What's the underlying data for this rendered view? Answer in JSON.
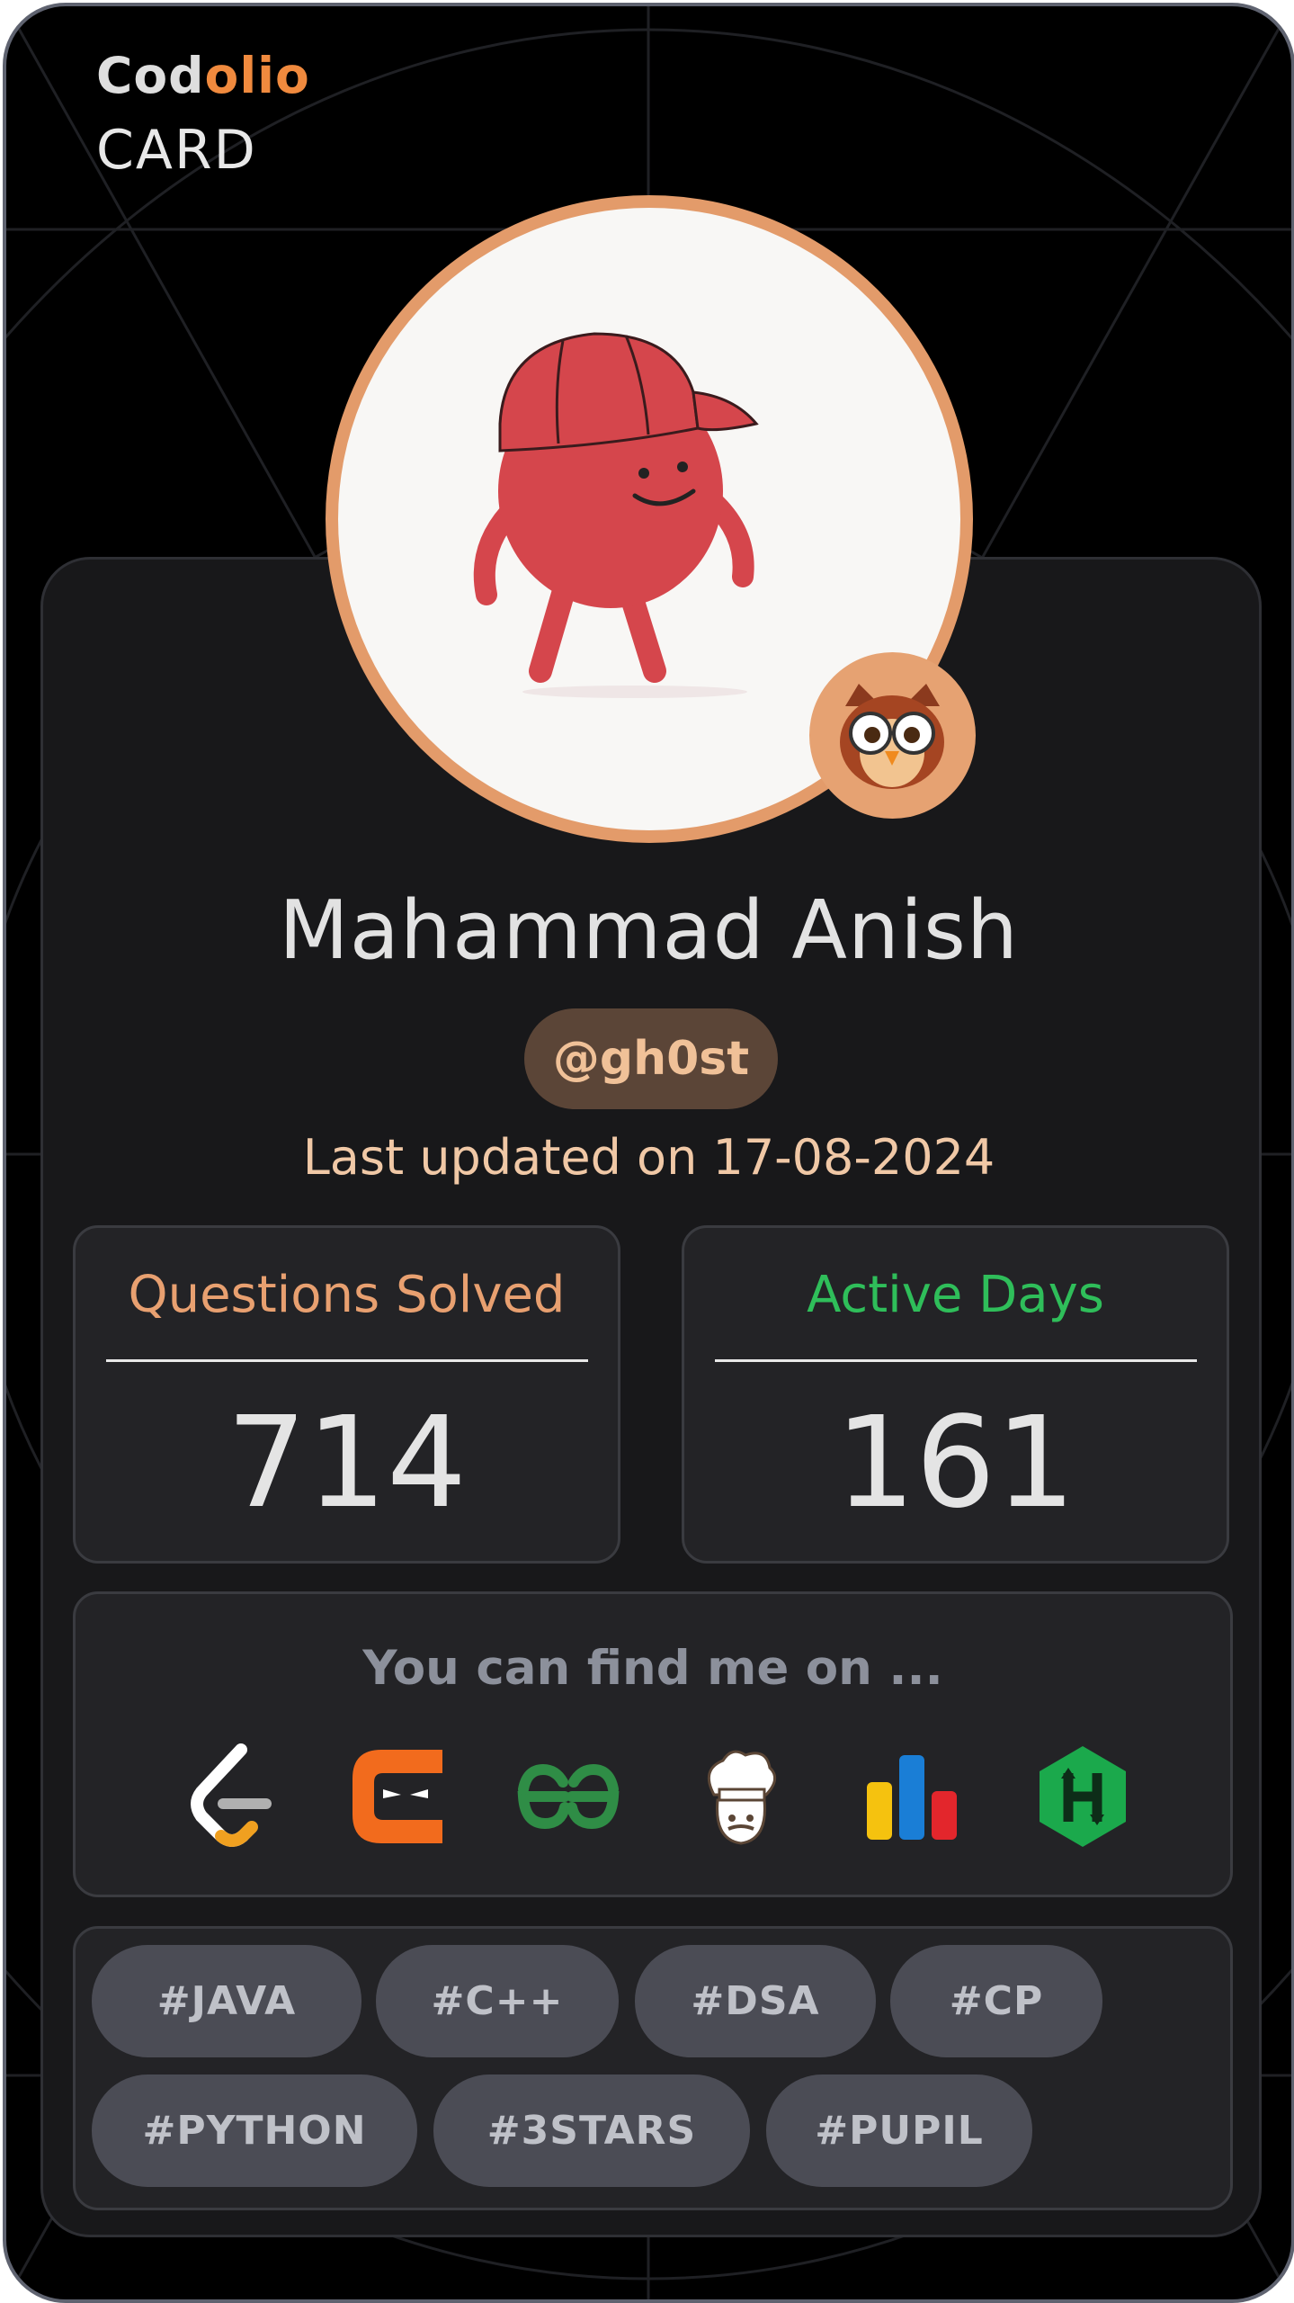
{
  "brand": {
    "part1": "Cod",
    "part2": "olio",
    "subtitle": "CARD"
  },
  "colors": {
    "accent": "#f08a3e",
    "ring": "#e39b6a",
    "green": "#2fbe5a"
  },
  "profile": {
    "name": "Mahammad Anish",
    "handle": "@gh0st",
    "last_updated": "Last updated on 17-08-2024",
    "avatar_icon": "red-character-cap-icon",
    "badge_icon": "owl-glasses-icon"
  },
  "stats": [
    {
      "label": "Questions Solved",
      "value": "714"
    },
    {
      "label": "Active Days",
      "value": "161"
    }
  ],
  "find": {
    "title": "You can find me on ...",
    "platforms": [
      "leetcode-icon",
      "codestudio-icon",
      "geeksforgeeks-icon",
      "codechef-icon",
      "codeforces-icon",
      "hackerrank-icon"
    ]
  },
  "tags": [
    "#JAVA",
    "#C++",
    "#DSA",
    "#CP",
    "#PYTHON",
    "#3STARS",
    "#PUPIL"
  ]
}
